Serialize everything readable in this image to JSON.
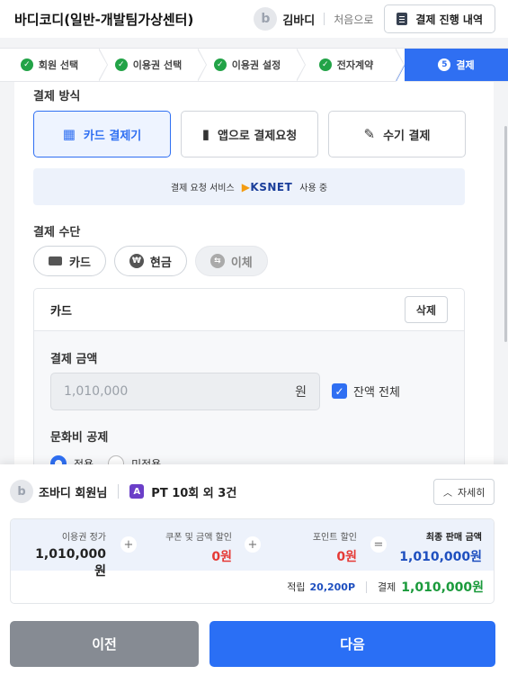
{
  "header": {
    "title": "바디코디(일반-개발팀가상센터)",
    "avatar_letter": "b",
    "user": "김바디",
    "home": "처음으로",
    "history_button": "결제 진행 내역"
  },
  "steps": [
    {
      "label": "회원 선택",
      "state": "done"
    },
    {
      "label": "이용권 선택",
      "state": "done"
    },
    {
      "label": "이용권 설정",
      "state": "done"
    },
    {
      "label": "전자계약",
      "state": "done"
    },
    {
      "label": "결제",
      "state": "active",
      "num": "5"
    }
  ],
  "payment_method": {
    "label": "결제 방식",
    "options": [
      "카드 결제기",
      "앱으로 결제요청",
      "수기 결제"
    ],
    "selected": "카드 결제기",
    "ksnet": {
      "prefix": "결제 요청 서비스",
      "logo": "KSNET",
      "suffix": "사용 중"
    }
  },
  "payment_means": {
    "label": "결제 수단",
    "chips": [
      {
        "label": "카드",
        "icon": "card-icon"
      },
      {
        "label": "현금",
        "icon": "won-icon"
      },
      {
        "label": "이체",
        "icon": "transfer-icon",
        "disabled": true
      }
    ]
  },
  "card_panel": {
    "title": "카드",
    "delete": "삭제",
    "amount_label": "결제 금액",
    "amount_value": "1,010,000",
    "amount_unit": "원",
    "full_balance": "잔액 전체",
    "culture_label": "문화비 공제",
    "radio_apply": "적용",
    "radio_none": "미적용"
  },
  "summary": {
    "member": "조바디 회원님",
    "badge": "A",
    "product": "PT 10회 외 3건",
    "detail_button": "자세히",
    "list_price_label": "이용권 정가",
    "list_price": "1,010,000원",
    "discount_label": "쿠폰 및 금액 할인",
    "discount": "0원",
    "point_label": "포인트 할인",
    "point": "0원",
    "final_label": "최종 판매 금액",
    "final": "1,010,000원",
    "earn_label": "적립",
    "earn": "20,200P",
    "pay_label": "결제",
    "pay": "1,010,000원"
  },
  "nav": {
    "prev": "이전",
    "next": "다음"
  },
  "colors": {
    "accent": "#2f6ff2",
    "success": "#22a347",
    "danger": "#e53935",
    "brand_purple": "#6b3fc8"
  }
}
